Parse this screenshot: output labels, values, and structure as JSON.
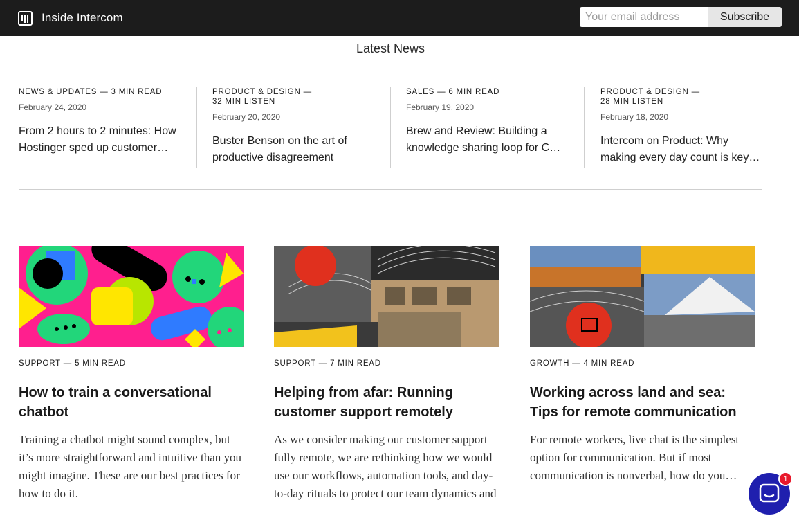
{
  "header": {
    "title": "Inside Intercom",
    "email_placeholder": "Your email address",
    "subscribe_label": "Subscribe"
  },
  "latest": {
    "title": "Latest News",
    "items": [
      {
        "category": "NEWS & UPDATES — 3 MIN READ",
        "date": "February 24, 2020",
        "title": "From 2 hours to 2 minutes: How Hostinger sped up customer…"
      },
      {
        "category": "PRODUCT & DESIGN — 32 MIN LISTEN",
        "date": "February 20, 2020",
        "title": "Buster Benson on the art of productive disagreement"
      },
      {
        "category": "SALES — 6 MIN READ",
        "date": "February 19, 2020",
        "title": "Brew and Review: Building a knowledge sharing loop for C…"
      },
      {
        "category": "PRODUCT & DESIGN — 28 MIN LISTEN",
        "date": "February 18, 2020",
        "title": "Intercom on Product: Why making every day count is key…"
      }
    ]
  },
  "cards": [
    {
      "meta": "SUPPORT — 5 MIN READ",
      "title": "How to train a conversational chatbot",
      "description": "Training a chatbot might sound complex, but it’s more straightforward and intuitive than you might imagine. These are our best practices for how to do it."
    },
    {
      "meta": "SUPPORT — 7 MIN READ",
      "title": "Helping from afar: Running customer support remotely",
      "description": "As we consider making our customer support fully remote, we are rethinking how we would use our workflows, automation tools, and day-to-day rituals to protect our team dynamics and"
    },
    {
      "meta": "GROWTH — 4 MIN READ",
      "title": "Working across land and sea: Tips for remote communication",
      "description": "For remote workers, live chat is the simplest option for communication. But if most communication is nonverbal, how do you…"
    }
  ],
  "messenger": {
    "badge_count": "1",
    "icon": "messenger-icon"
  }
}
